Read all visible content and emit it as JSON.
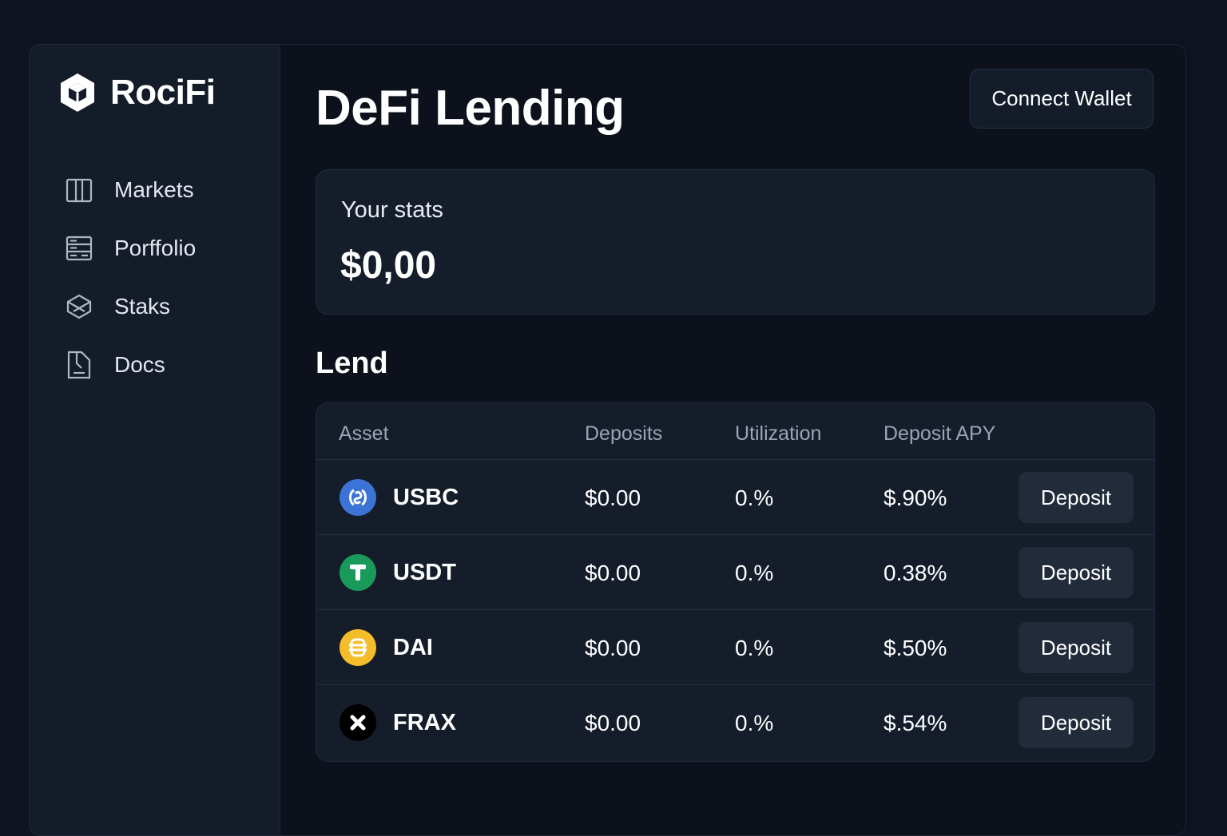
{
  "brand": {
    "name": "RociFi",
    "logo_icon": "cube-logo-icon"
  },
  "sidebar": {
    "items": [
      {
        "label": "Markets",
        "icon": "columns-icon"
      },
      {
        "label": "Porffolio",
        "icon": "server-rack-icon"
      },
      {
        "label": "Staks",
        "icon": "stack-cube-icon"
      },
      {
        "label": "Docs",
        "icon": "document-icon"
      }
    ]
  },
  "header": {
    "title": "DeFi Lending",
    "connect_label": "Connect Wallet"
  },
  "stats": {
    "label": "Your stats",
    "value": "$0,00"
  },
  "lend": {
    "title": "Lend",
    "columns": [
      "Asset",
      "Deposits",
      "Utilization",
      "Deposit APY"
    ],
    "rows": [
      {
        "asset": "USBC",
        "icon": "usdc-coin-icon",
        "color": "#3b73d6",
        "deposits": "$0.00",
        "utilization": "0.%",
        "apy": "$.90%",
        "action": "Deposit"
      },
      {
        "asset": "USDT",
        "icon": "tether-coin-icon",
        "color": "#1a9a5a",
        "deposits": "$0.00",
        "utilization": "0.%",
        "apy": "0.38%",
        "action": "Deposit"
      },
      {
        "asset": "DAI",
        "icon": "dai-coin-icon",
        "color": "#f4bd2a",
        "deposits": "$0.00",
        "utilization": "0.%",
        "apy": "$.50%",
        "action": "Deposit"
      },
      {
        "asset": "FRAX",
        "icon": "frax-coin-icon",
        "color": "#000000",
        "deposits": "$0.00",
        "utilization": "0.%",
        "apy": "$.54%",
        "action": "Deposit"
      }
    ]
  },
  "colors": {
    "background": "#0d1320",
    "panel": "#151d2b",
    "sidebar": "#141c2a",
    "text": "#ffffff",
    "muted": "#9aa4b5"
  }
}
